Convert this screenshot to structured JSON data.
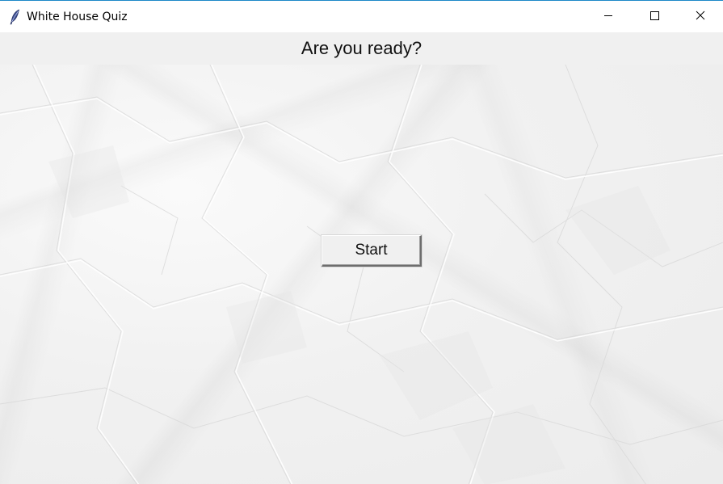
{
  "window": {
    "title": "White House Quiz",
    "app_icon": "feather-icon",
    "controls": {
      "minimize_icon": "minimize-icon",
      "maximize_icon": "maximize-icon",
      "close_icon": "close-icon"
    }
  },
  "header": {
    "text": "Are you ready?"
  },
  "main": {
    "background": "crumpled-paper-texture",
    "start_label": "Start"
  },
  "colors": {
    "titlebar_border": "#1c88c7",
    "header_bg": "#f0f0f0",
    "button_bg": "#f0f0f0"
  }
}
